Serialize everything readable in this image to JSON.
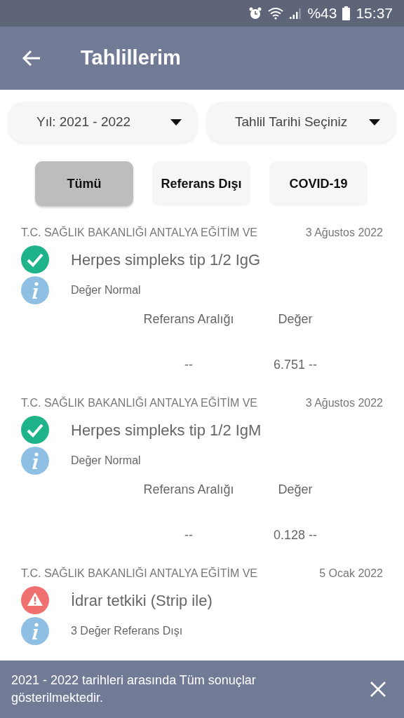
{
  "status_bar": {
    "battery": "%43",
    "time": "15:37"
  },
  "app_bar": {
    "title": "Tahlillerim"
  },
  "filters": [
    {
      "label": "Yıl: 2021 - 2022"
    },
    {
      "label": "Tahlil Tarihi Seçiniz"
    }
  ],
  "tabs": [
    {
      "label": "Tümü",
      "selected": true
    },
    {
      "label": "Referans Dışı",
      "selected": false
    },
    {
      "label": "COVID-19",
      "selected": false
    }
  ],
  "results": [
    {
      "institution": "T.C. SAĞLIK BAKANLIĞI ANTALYA EĞİTİM VE",
      "date": "3 Ağustos 2022",
      "test": "Herpes simpleks tip 1/2 IgG",
      "kind": "normal",
      "note": "Değer Normal",
      "columns": [
        "Referans Aralığı",
        "Değer"
      ],
      "values": [
        "--",
        "6.751 --"
      ]
    },
    {
      "institution": "T.C. SAĞLIK BAKANLIĞI ANTALYA EĞİTİM VE",
      "date": "3 Ağustos 2022",
      "test": "Herpes simpleks tip 1/2 IgM",
      "kind": "normal",
      "note": "Değer Normal",
      "columns": [
        "Referans Aralığı",
        "Değer"
      ],
      "values": [
        "--",
        "0.128 --"
      ]
    },
    {
      "institution": "T.C. SAĞLIK BAKANLIĞI ANTALYA EĞİTİM VE",
      "date": "5 Ocak 2022",
      "test": "İdrar tetkiki (Strip ile)",
      "kind": "abnormal",
      "note": "3 Değer Referans Dışı"
    }
  ],
  "snackbar": {
    "message": "2021 - 2022 tarihleri arasında Tüm sonuçlar gösterilmektedir."
  }
}
